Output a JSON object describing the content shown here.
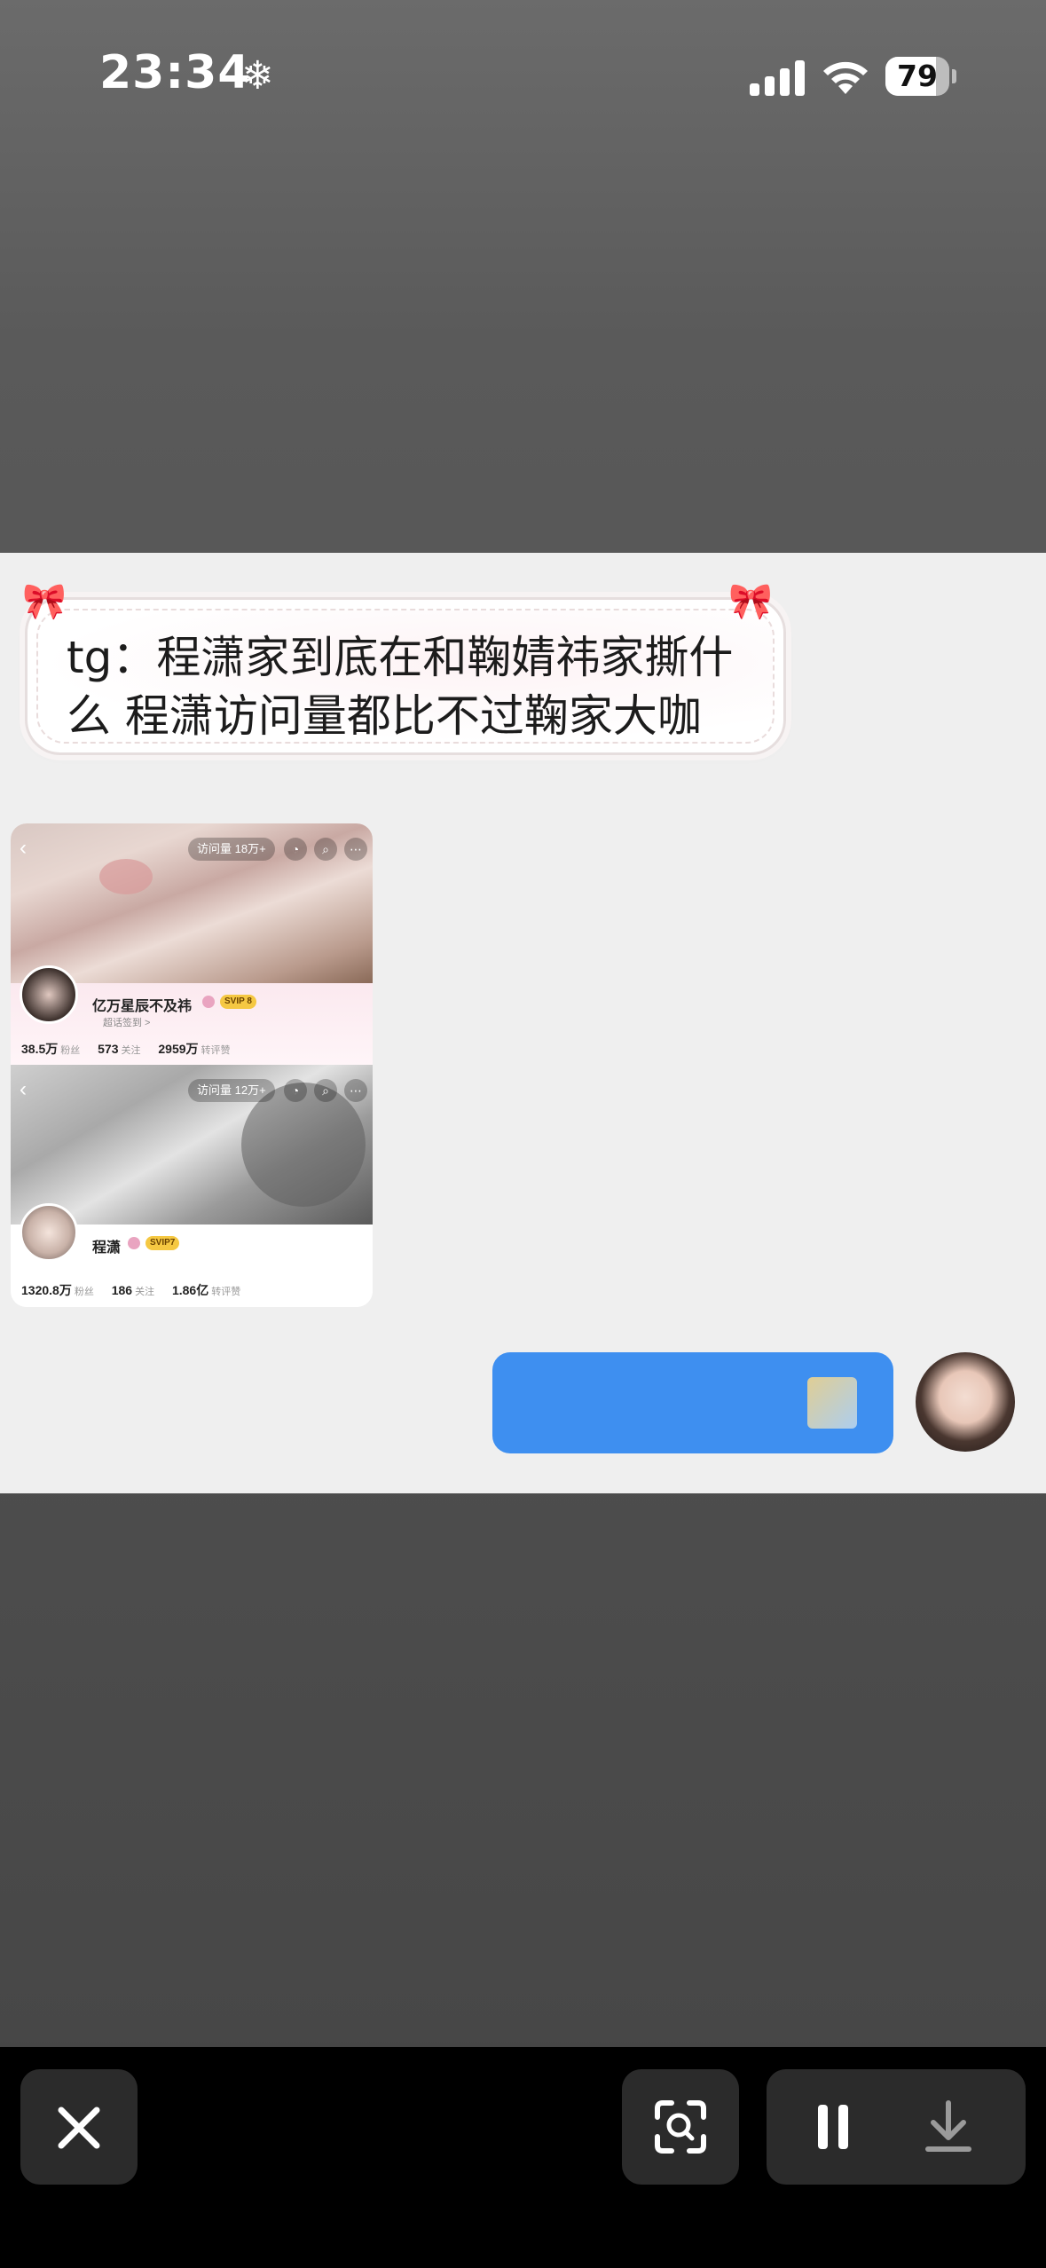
{
  "status_bar": {
    "time": "23:34",
    "weather_icon": "snowflake-icon",
    "battery": "79",
    "battery_level_percent": 79
  },
  "message": {
    "text": "tg：程潇家到底在和鞠婧祎家撕什么 程潇访问量都比不过鞠家大咖"
  },
  "screenshot_card": {
    "profile1": {
      "visits": "访问量 18万+",
      "name": "亿万星辰不及祎",
      "vip": "SVIP 8",
      "sub": "超话签到 >",
      "stats": [
        {
          "value": "38.5万",
          "label": "粉丝"
        },
        {
          "value": "573",
          "label": "关注"
        },
        {
          "value": "2959万",
          "label": "转评赞"
        }
      ]
    },
    "profile2": {
      "visits": "访问量 12万+",
      "name": "程潇",
      "vip": "SVIP7",
      "stats": [
        {
          "value": "1320.8万",
          "label": "粉丝"
        },
        {
          "value": "186",
          "label": "关注"
        },
        {
          "value": "1.86亿",
          "label": "转评赞"
        }
      ]
    }
  },
  "toolbar": {
    "close_icon": "close-icon",
    "scan_icon": "scan-icon",
    "pause_icon": "pause-icon",
    "download_icon": "download-icon"
  }
}
